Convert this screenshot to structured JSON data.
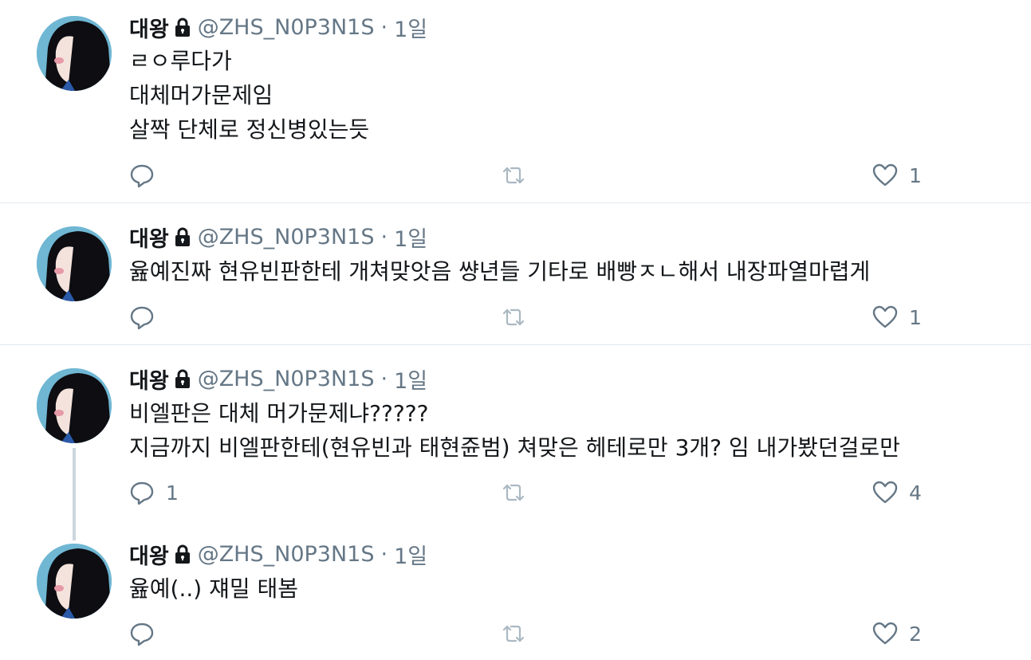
{
  "tweets": [
    {
      "name": "대왕",
      "handle": "@ZHS_N0P3N1S",
      "separator": "·",
      "time": "1일",
      "lines": [
        "ㄹㅇ루다가",
        "대체머가문제임",
        "살짝 단체로 정신병있는듯"
      ],
      "reply_count": "",
      "retweet_count": "",
      "like_count": "1"
    },
    {
      "name": "대왕",
      "handle": "@ZHS_N0P3N1S",
      "separator": "·",
      "time": "1일",
      "lines": [
        "윮예진짜 현유빈판한테 개쳐맞앗음 썅년들 기타로 배빵ㅈㄴ해서 내장파열마렵게"
      ],
      "reply_count": "",
      "retweet_count": "",
      "like_count": "1"
    },
    {
      "name": "대왕",
      "handle": "@ZHS_N0P3N1S",
      "separator": "·",
      "time": "1일",
      "lines": [
        "비엘판은 대체 머가문제냐?????",
        "지금까지 비엘판한테(현유빈과 태현쥰범) 쳐맞은 헤테로만 3개? 임 내가봤던걸로만"
      ],
      "reply_count": "1",
      "retweet_count": "",
      "like_count": "4"
    },
    {
      "name": "대왕",
      "handle": "@ZHS_N0P3N1S",
      "separator": "·",
      "time": "1일",
      "lines": [
        "윮예(..) 쟤밀 태봄"
      ],
      "reply_count": "",
      "retweet_count": "",
      "like_count": "2"
    }
  ],
  "icons": {
    "lock": "lock-icon",
    "reply": "reply-icon",
    "retweet": "retweet-icon",
    "like": "heart-icon"
  },
  "colors": {
    "text": "#14171a",
    "secondary": "#657786",
    "divider": "#e1e8ed",
    "thread_line": "#ccd6dd"
  }
}
